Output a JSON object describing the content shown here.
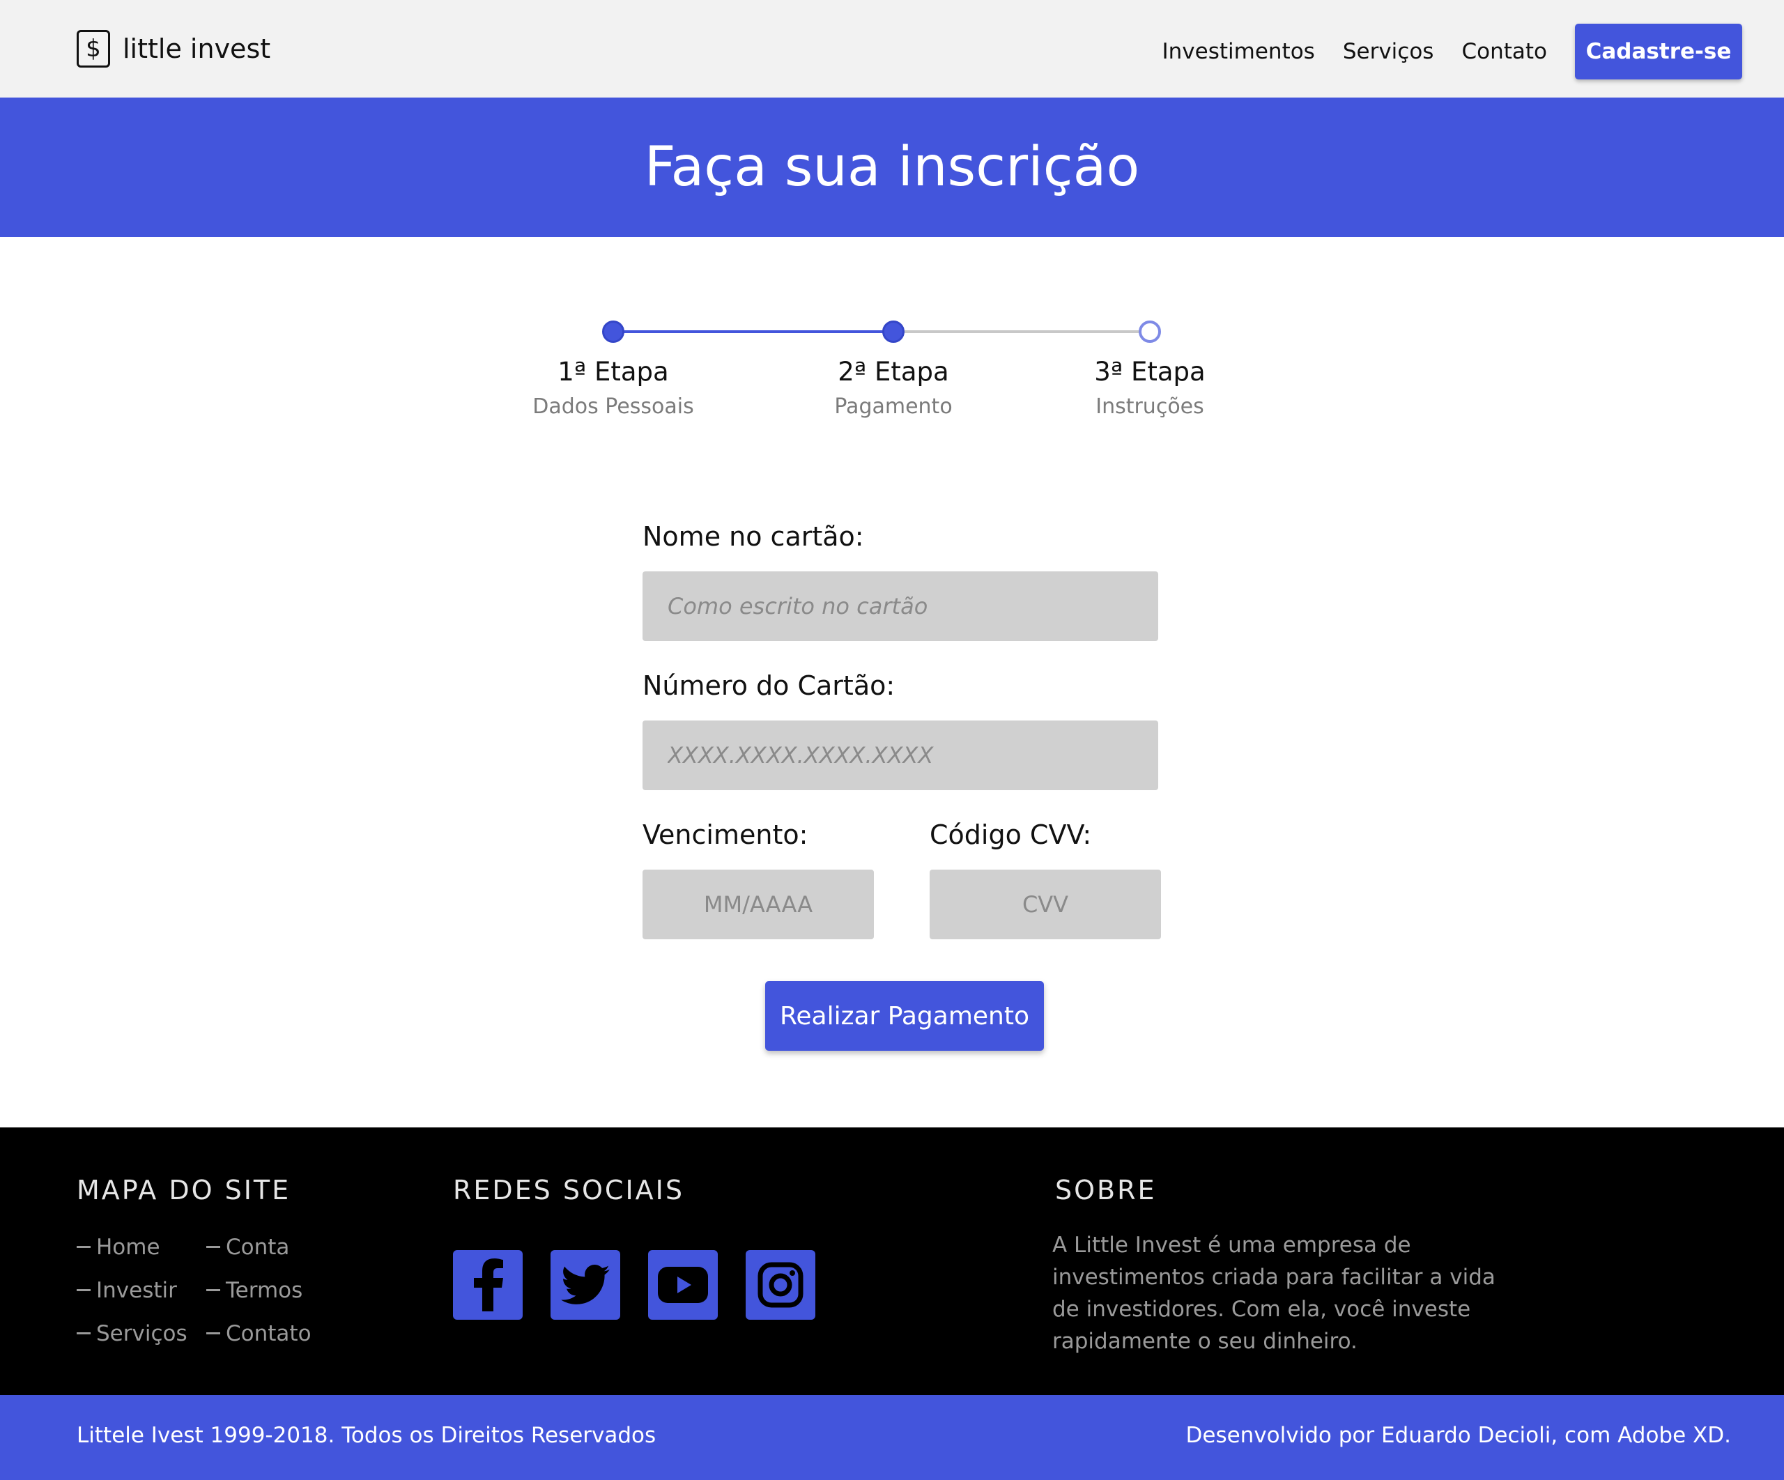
{
  "header": {
    "logo_symbol": "$",
    "logo_text": "little invest",
    "nav": [
      "Investimentos",
      "Serviços",
      "Contato"
    ],
    "cta_label": "Cadastre-se"
  },
  "hero": {
    "title": "Faça sua inscrição"
  },
  "stepper": {
    "steps": [
      {
        "title": "1ª Etapa",
        "subtitle": "Dados Pessoais",
        "state": "completed"
      },
      {
        "title": "2ª Etapa",
        "subtitle": "Pagamento",
        "state": "current"
      },
      {
        "title": "3ª Etapa",
        "subtitle": "Instruções",
        "state": "pending"
      }
    ]
  },
  "form": {
    "name_label": "Nome no cartão:",
    "name_placeholder": "Como escrito no cartão",
    "number_label": "Número do Cartão:",
    "number_placeholder": "XXXX.XXXX.XXXX.XXXX",
    "expiry_label": "Vencimento:",
    "expiry_placeholder": "MM/AAAA",
    "cvv_label": "Código CVV:",
    "cvv_placeholder": "CVV",
    "submit_label": "Realizar Pagamento"
  },
  "footer": {
    "sitemap_title": "MAPA DO SITE",
    "sitemap_col1": [
      "Home",
      "Investir",
      "Serviços"
    ],
    "sitemap_col2": [
      "Conta",
      "Termos",
      "Contato"
    ],
    "social_title": "REDES SOCIAIS",
    "social_icons": [
      "facebook-icon",
      "twitter-icon",
      "youtube-icon",
      "instagram-icon"
    ],
    "about_title": "SOBRE",
    "about_text": "A Little Invest é uma empresa de investimentos criada para facilitar a vida de investidores. Com ela, você investe rapidamente o seu dinheiro."
  },
  "bottom_bar": {
    "copyright": "Littele Ivest 1999-2018. Todos os Direitos Reservados",
    "credit": "Desenvolvido por Eduardo Decioli, com Adobe XD."
  },
  "colors": {
    "accent": "#4355dc",
    "header_bg": "#f2f2f2",
    "footer_bg": "#000000",
    "input_bg": "#d0d0d0"
  }
}
